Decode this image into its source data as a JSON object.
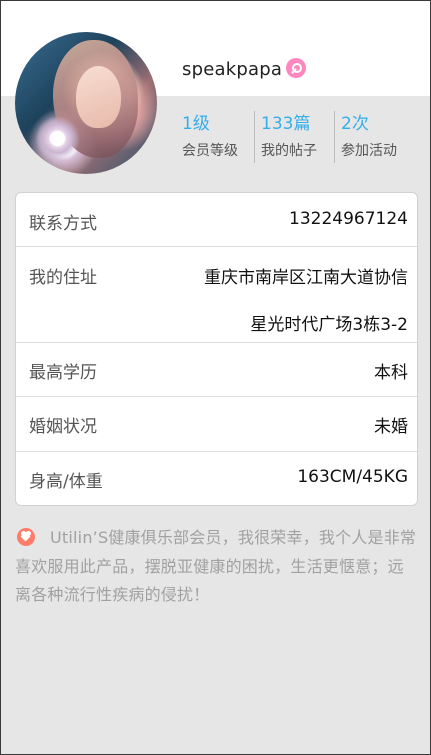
{
  "profile": {
    "username": "speakpapa",
    "avatar_icon": "avatar-photo",
    "vip_icon": "vip-badge-icon",
    "stats": [
      {
        "value": "1级",
        "label": "会员等级"
      },
      {
        "value": "133篇",
        "label": "我的帖子"
      },
      {
        "value": "2次",
        "label": "参加活动"
      }
    ]
  },
  "info": {
    "contact": {
      "label": "联系方式",
      "value": "13224967124"
    },
    "address": {
      "label": "我的住址",
      "line1": "重庆市南岸区江南大道协信",
      "line2": "星光时代广场3栋3-2"
    },
    "education": {
      "label": "最高学历",
      "value": "本科"
    },
    "marital": {
      "label": "婚姻状况",
      "value": "未婚"
    },
    "height_weight": {
      "label": "身高/体重",
      "value": "163CM/45KG"
    }
  },
  "intro": {
    "icon": "heart-icon",
    "text": "Utilin’S健康俱乐部会员，我很荣幸，我个人是非常喜欢服用此产品，摆脱亚健康的困扰，生活更惬意；远离各种流行性疾病的侵扰！"
  },
  "colors": {
    "accent": "#34aee8",
    "background": "#e6e6e6",
    "heart": "#ff7c6b",
    "badge": "#ff87bf"
  }
}
